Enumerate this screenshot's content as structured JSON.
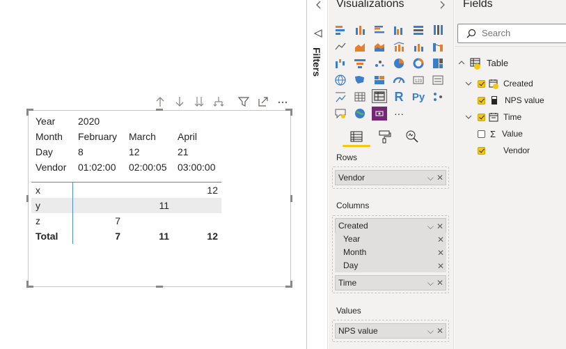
{
  "matrix": {
    "header_rows": [
      {
        "label": "Year",
        "values": [
          "2020",
          "",
          ""
        ]
      },
      {
        "label": "Month",
        "values": [
          "February",
          "March",
          "April"
        ]
      },
      {
        "label": "Day",
        "values": [
          "8",
          "12",
          "21"
        ]
      },
      {
        "label": "Vendor",
        "values": [
          "01:02:00",
          "02:00:05",
          "03:00:00"
        ]
      }
    ],
    "rows": [
      {
        "label": "x",
        "values": [
          "",
          "",
          "12"
        ]
      },
      {
        "label": "y",
        "values": [
          "",
          "11",
          ""
        ]
      },
      {
        "label": "z",
        "values": [
          "7",
          "",
          ""
        ]
      }
    ],
    "total": {
      "label": "Total",
      "values": [
        "7",
        "11",
        "12"
      ]
    }
  },
  "visual_toolbar": [
    "drill-up-icon",
    "drill-down-icon",
    "expand-all-down-icon",
    "expand-hierarchy-icon",
    "filter-icon",
    "focus-mode-icon",
    "more-options-icon"
  ],
  "filters": {
    "label": "Filters"
  },
  "visualizations": {
    "title": "Visualizations",
    "selected_visual": "matrix-icon",
    "rows_label": "Rows",
    "rows_field": "Vendor",
    "columns_label": "Columns",
    "columns_field": "Created",
    "columns_subfields": [
      "Year",
      "Month",
      "Day"
    ],
    "columns_field_2": "Time",
    "values_label": "Values",
    "values_field": "NPS value",
    "more_label": "···",
    "r_label": "R",
    "py_label": "Py"
  },
  "fields": {
    "title": "Fields",
    "search_placeholder": "Search",
    "table_name": "Table",
    "created": "Created",
    "nps_value": "NPS value",
    "time": "Time",
    "value": "Value",
    "vendor": "Vendor"
  },
  "colors": {
    "accent": "#f2c811",
    "divider": "#4a90c8",
    "pane_bg": "#f3f2f1"
  }
}
